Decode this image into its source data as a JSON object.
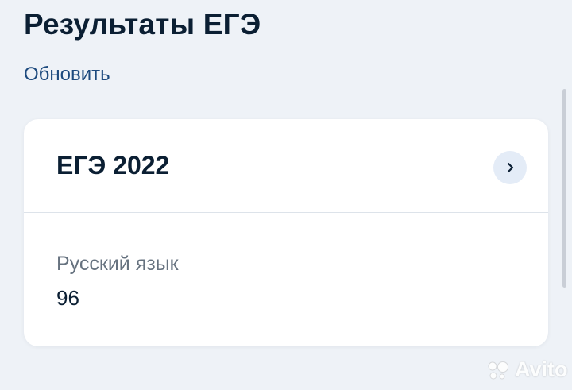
{
  "header": {
    "title": "Результаты ЕГЭ",
    "refresh_label": "Обновить"
  },
  "card": {
    "exam_title": "ЕГЭ 2022",
    "chevron_icon": "chevron-right-icon",
    "results": [
      {
        "subject": "Русский язык",
        "score": "96"
      }
    ]
  },
  "watermark": {
    "text": "Avito"
  },
  "colors": {
    "background": "#eef2f7",
    "card": "#ffffff",
    "title_text": "#0b1f33",
    "link": "#1d4a7e",
    "muted_text": "#66727f",
    "chevron_bg": "#e4ecf7"
  }
}
